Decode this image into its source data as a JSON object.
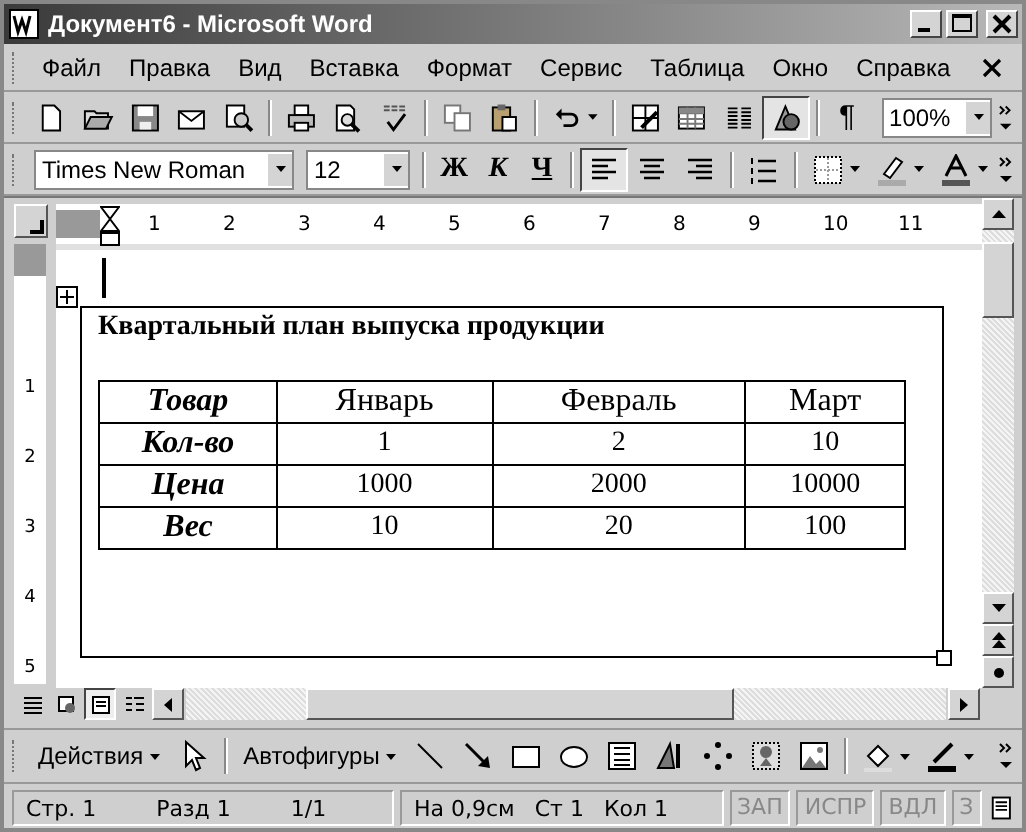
{
  "window": {
    "title": "Документ6 - Microsoft Word"
  },
  "menu": [
    "Файл",
    "Правка",
    "Вид",
    "Вставка",
    "Формат",
    "Сервис",
    "Таблица",
    "Окно",
    "Справка"
  ],
  "standard_toolbar": {
    "buttons": [
      {
        "kind": "new",
        "pressed": false
      },
      {
        "kind": "open",
        "pressed": false
      },
      {
        "kind": "save",
        "pressed": false
      },
      {
        "kind": "mail",
        "pressed": false
      },
      {
        "kind": "research",
        "pressed": false
      },
      {
        "kind": "sep"
      },
      {
        "kind": "print",
        "pressed": false
      },
      {
        "kind": "preview",
        "pressed": false
      },
      {
        "kind": "spelling",
        "pressed": false
      },
      {
        "kind": "sep"
      },
      {
        "kind": "copy",
        "pressed": false
      },
      {
        "kind": "paste",
        "pressed": false
      },
      {
        "kind": "sep"
      },
      {
        "kind": "undo",
        "pressed": false
      },
      {
        "kind": "sep"
      },
      {
        "kind": "tables",
        "pressed": false
      },
      {
        "kind": "insert-table",
        "pressed": false
      },
      {
        "kind": "columns",
        "pressed": false
      },
      {
        "kind": "drawing",
        "pressed": true
      },
      {
        "kind": "sep"
      },
      {
        "kind": "pilcrow",
        "label": "¶",
        "pressed": false
      }
    ],
    "zoom": "100%"
  },
  "formatting_toolbar": {
    "font": "Times New Roman",
    "size": "12",
    "buttons": [
      {
        "kind": "bold",
        "label": "Ж",
        "pressed": false
      },
      {
        "kind": "italic",
        "label": "К",
        "pressed": false
      },
      {
        "kind": "underline",
        "label": "Ч",
        "pressed": false
      },
      {
        "kind": "sep"
      },
      {
        "kind": "align-left",
        "pressed": true
      },
      {
        "kind": "align-center",
        "pressed": false
      },
      {
        "kind": "align-right",
        "pressed": false
      },
      {
        "kind": "sep"
      },
      {
        "kind": "numbering",
        "pressed": false
      },
      {
        "kind": "sep"
      },
      {
        "kind": "borders",
        "pressed": false
      },
      {
        "kind": "highlight",
        "pressed": false
      },
      {
        "kind": "font-color",
        "pressed": false
      }
    ]
  },
  "ruler": {
    "numbers": [
      "1",
      "2",
      "3",
      "4",
      "5",
      "6",
      "7",
      "8",
      "9",
      "10",
      "11"
    ]
  },
  "vertical_ruler": {
    "numbers": [
      "1",
      "2",
      "3",
      "4",
      "5"
    ]
  },
  "document": {
    "heading": "Квартальный план выпуска продукции",
    "table": {
      "columns": [
        "Товар",
        "Январь",
        "Февраль",
        "Март"
      ],
      "rows": [
        [
          "Кол-во",
          "1",
          "2",
          "10"
        ],
        [
          "Цена",
          "1000",
          "2000",
          "10000"
        ],
        [
          "Вес",
          "10",
          "20",
          "100"
        ]
      ]
    }
  },
  "view_buttons": [
    {
      "kind": "normal",
      "selected": false
    },
    {
      "kind": "web",
      "selected": false
    },
    {
      "kind": "print",
      "selected": true
    },
    {
      "kind": "outline",
      "selected": false
    }
  ],
  "drawing_toolbar": {
    "actions": "Действия",
    "autoshapes": "Автофигуры"
  },
  "status_bar": {
    "fields": [
      "Стр. 1",
      "Разд 1",
      "1/1",
      "На 0,9см",
      "Ст 1",
      "Кол 1"
    ],
    "modes": [
      {
        "label": "ЗАП",
        "on": false
      },
      {
        "label": "ИСПР",
        "on": false
      },
      {
        "label": "ВДЛ",
        "on": false
      },
      {
        "label": "З",
        "on": false
      }
    ]
  }
}
